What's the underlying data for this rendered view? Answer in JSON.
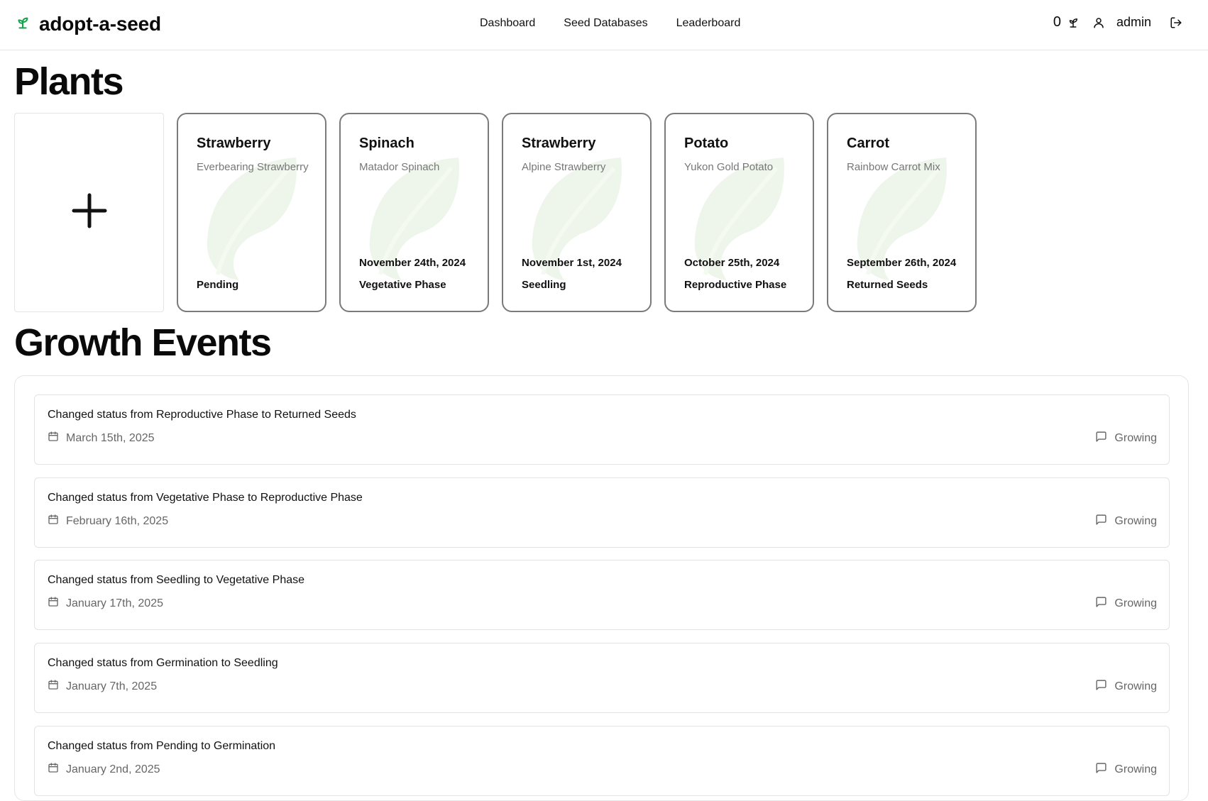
{
  "app": {
    "name": "adopt-a-seed"
  },
  "nav": {
    "items": [
      "Dashboard",
      "Seed Databases",
      "Leaderboard"
    ]
  },
  "user": {
    "seed_count": "0",
    "username": "admin"
  },
  "plants_section": {
    "title": "Plants"
  },
  "plants": [
    {
      "name": "Strawberry",
      "variety": "Everbearing Strawberry",
      "date": "",
      "status": "Pending"
    },
    {
      "name": "Spinach",
      "variety": "Matador Spinach",
      "date": "November 24th, 2024",
      "status": "Vegetative Phase"
    },
    {
      "name": "Strawberry",
      "variety": "Alpine Strawberry",
      "date": "November 1st, 2024",
      "status": "Seedling"
    },
    {
      "name": "Potato",
      "variety": "Yukon Gold Potato",
      "date": "October 25th, 2024",
      "status": "Reproductive Phase"
    },
    {
      "name": "Carrot",
      "variety": "Rainbow Carrot Mix",
      "date": "September 26th, 2024",
      "status": "Returned Seeds"
    }
  ],
  "events_section": {
    "title": "Growth Events"
  },
  "events": [
    {
      "text": "Changed status from Reproductive Phase to Returned Seeds",
      "date": "March 15th, 2025",
      "tag": "Growing"
    },
    {
      "text": "Changed status from Vegetative Phase to Reproductive Phase",
      "date": "February 16th, 2025",
      "tag": "Growing"
    },
    {
      "text": "Changed status from Seedling to Vegetative Phase",
      "date": "January 17th, 2025",
      "tag": "Growing"
    },
    {
      "text": "Changed status from Germination to Seedling",
      "date": "January 7th, 2025",
      "tag": "Growing"
    },
    {
      "text": "Changed status from Pending to Germination",
      "date": "January 2nd, 2025",
      "tag": "Growing"
    }
  ],
  "colors": {
    "brand_green": "#16a34a",
    "leaf_tint": "#eef6ec"
  }
}
